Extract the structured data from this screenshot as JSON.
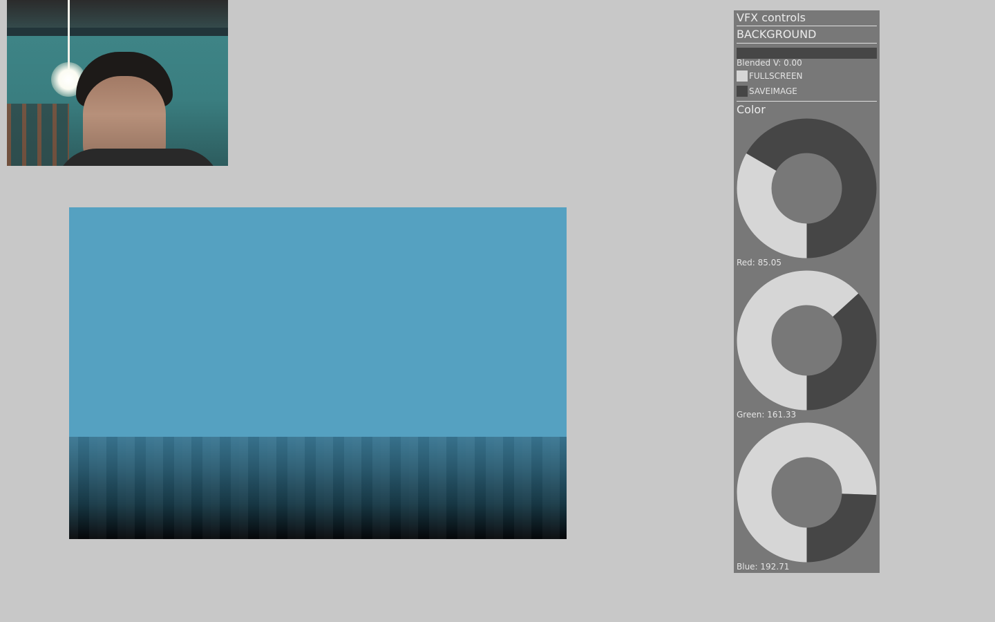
{
  "panel": {
    "title": "VFX controls",
    "background_section": "BACKGROUND",
    "blended_label": "Blended V: 0.00",
    "blended_value": 0.0,
    "fullscreen_label": "FULLSCREEN",
    "fullscreen_on": true,
    "saveimage_label": "SAVEIMAGE",
    "saveimage_on": false,
    "color_section": "Color",
    "knobs": [
      {
        "label": "Red: 85.05",
        "value": 85.05,
        "max": 255
      },
      {
        "label": "Green: 161.33",
        "value": 161.33,
        "max": 255
      },
      {
        "label": "Blue: 192.71",
        "value": 192.71,
        "max": 255
      }
    ]
  },
  "colors": {
    "app_background": "#c8c8c8",
    "panel": "#787878",
    "panel_dark": "#464646",
    "panel_light": "#d6d6d6",
    "render_color": "#55a1c1"
  }
}
